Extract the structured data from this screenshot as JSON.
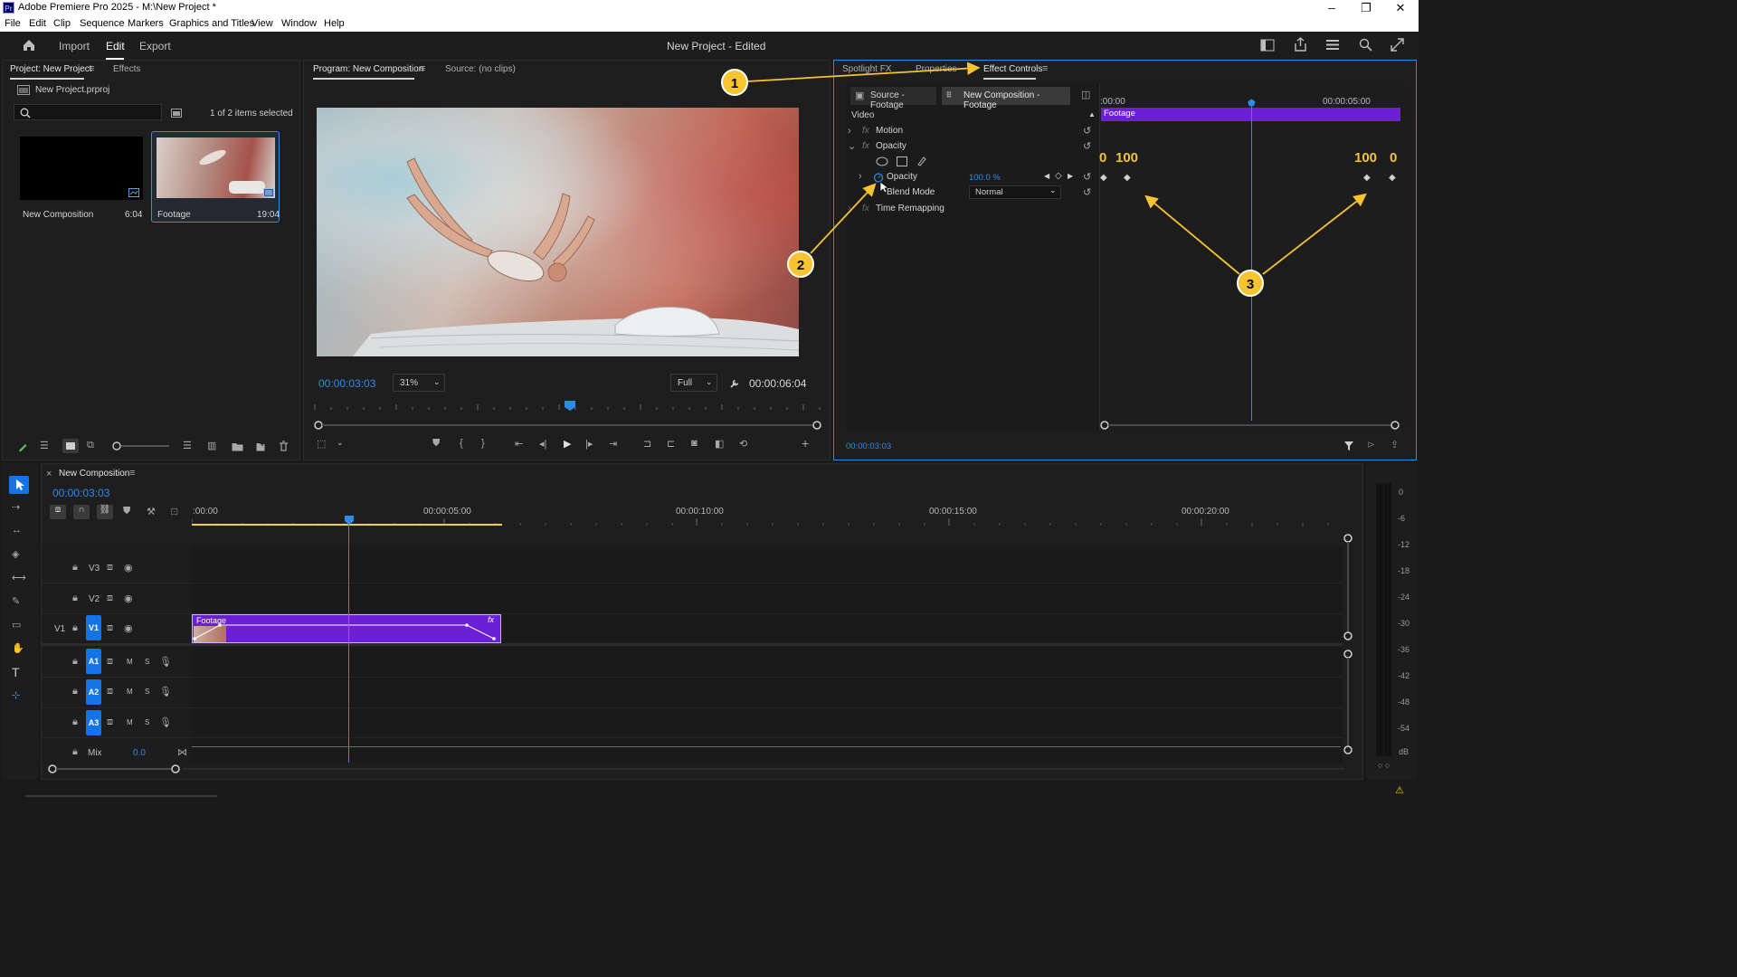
{
  "window": {
    "title": "Adobe Premiere Pro 2025 - M:\\New Project *",
    "app_icon": "Pr",
    "controls": [
      "–",
      "❐",
      "✕"
    ]
  },
  "menu": [
    "File",
    "Edit",
    "Clip",
    "Sequence",
    "Markers",
    "Graphics and Titles",
    "View",
    "Window",
    "Help"
  ],
  "header": {
    "nav": [
      "Import",
      "Edit",
      "Export"
    ],
    "active_nav": "Edit",
    "project_title": "New Project - Edited"
  },
  "project_panel": {
    "tab_project": "Project: New Project",
    "tab_effects": "Effects",
    "file": "New Project.prproj",
    "selection_status": "1 of 2 items selected",
    "search_placeholder": "",
    "items": [
      {
        "name": "New Composition",
        "duration": "6:04"
      },
      {
        "name": "Footage",
        "duration": "19:04"
      }
    ]
  },
  "program_monitor": {
    "tab_program": "Program: New Composition",
    "tab_source": "Source: (no clips)",
    "timecode": "00:00:03:03",
    "zoom": "31%",
    "quality": "Full",
    "duration": "00:00:06:04"
  },
  "effect_controls": {
    "tab_spotlight": "Spotlight FX",
    "tab_properties": "Properties",
    "tab_effect_controls": "Effect Controls",
    "source_btn": "Source - Footage",
    "comp_btn": "New Composition - Footage",
    "section_video": "Video",
    "effects": [
      "Motion",
      "Opacity",
      "Time Remapping"
    ],
    "opacity_label": "Opacity",
    "opacity_value": "100.0 %",
    "blend_label": "Blend Mode",
    "blend_value": "Normal",
    "ruler_start": ":00:00",
    "ruler_end": "00:00:05:00",
    "clip_label": "Footage",
    "kf_left_a": "0",
    "kf_left_b": "100",
    "kf_right_a": "100",
    "kf_right_b": "0",
    "timecode": "00:00:03:03"
  },
  "callouts": [
    "1",
    "2",
    "3"
  ],
  "timeline": {
    "title": "New Composition",
    "timecode": "00:00:03:03",
    "ruler": [
      ":00:00",
      "00:00:05:00",
      "00:00:10:00",
      "00:00:15:00",
      "00:00:20:00"
    ],
    "video_tracks": [
      "V3",
      "V2",
      "V1"
    ],
    "v1_source": "V1",
    "audio_tracks": [
      "A1",
      "A2",
      "A3"
    ],
    "mix_label": "Mix",
    "mix_value": "0.0",
    "clip_name": "Footage",
    "clip_fx": "fx",
    "track_m": "M",
    "track_s": "S"
  },
  "meter": {
    "labels": [
      "0",
      "-6",
      "-12",
      "-18",
      "-24",
      "-30",
      "-36",
      "-42",
      "-48",
      "-54",
      "dB"
    ],
    "solo": "○ ○"
  },
  "colors": {
    "accent_blue": "#2d8ceb",
    "clip_purple": "#6b1fd6",
    "callout_yellow": "#f6c431"
  }
}
